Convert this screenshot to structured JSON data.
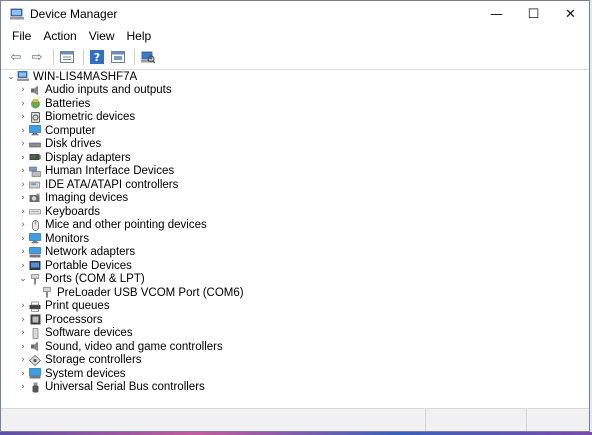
{
  "window": {
    "title": "Device Manager",
    "controls": {
      "minimize": "—",
      "maximize": "☐",
      "close": "✕"
    }
  },
  "menu": [
    "File",
    "Action",
    "View",
    "Help"
  ],
  "toolbar": {
    "back": "⇦",
    "forward": "⇨",
    "buttons": [
      "properties-icon",
      "help-icon",
      "view-icon",
      "scan-hardware-icon"
    ]
  },
  "tree": {
    "root": "WIN-LIS4MASHF7A",
    "categories": [
      {
        "label": "Audio inputs and outputs",
        "icon": "speaker-icon",
        "expanded": false
      },
      {
        "label": "Batteries",
        "icon": "battery-icon",
        "expanded": false
      },
      {
        "label": "Biometric devices",
        "icon": "fingerprint-icon",
        "expanded": false
      },
      {
        "label": "Computer",
        "icon": "monitor-icon",
        "expanded": false
      },
      {
        "label": "Disk drives",
        "icon": "disk-icon",
        "expanded": false
      },
      {
        "label": "Display adapters",
        "icon": "display-adapter-icon",
        "expanded": false
      },
      {
        "label": "Human Interface Devices",
        "icon": "hid-icon",
        "expanded": false
      },
      {
        "label": "IDE ATA/ATAPI controllers",
        "icon": "ide-icon",
        "expanded": false
      },
      {
        "label": "Imaging devices",
        "icon": "camera-icon",
        "expanded": false
      },
      {
        "label": "Keyboards",
        "icon": "keyboard-icon",
        "expanded": false
      },
      {
        "label": "Mice and other pointing devices",
        "icon": "mouse-icon",
        "expanded": false
      },
      {
        "label": "Monitors",
        "icon": "monitor-icon",
        "expanded": false
      },
      {
        "label": "Network adapters",
        "icon": "network-icon",
        "expanded": false
      },
      {
        "label": "Portable Devices",
        "icon": "portable-icon",
        "expanded": false
      },
      {
        "label": "Ports (COM & LPT)",
        "icon": "port-icon",
        "expanded": true,
        "children": [
          "PreLoader USB VCOM Port (COM6)"
        ]
      },
      {
        "label": "Print queues",
        "icon": "printer-icon",
        "expanded": false
      },
      {
        "label": "Processors",
        "icon": "cpu-icon",
        "expanded": false
      },
      {
        "label": "Software devices",
        "icon": "software-icon",
        "expanded": false
      },
      {
        "label": "Sound, video and game controllers",
        "icon": "speaker-icon",
        "expanded": false
      },
      {
        "label": "Storage controllers",
        "icon": "storage-icon",
        "expanded": false
      },
      {
        "label": "System devices",
        "icon": "system-icon",
        "expanded": false
      },
      {
        "label": "Universal Serial Bus controllers",
        "icon": "usb-icon",
        "expanded": false
      }
    ]
  },
  "colors": {
    "icon_blue": "#2f7fd6",
    "icon_gray": "#6b6b6b",
    "arrow": "#555555"
  }
}
